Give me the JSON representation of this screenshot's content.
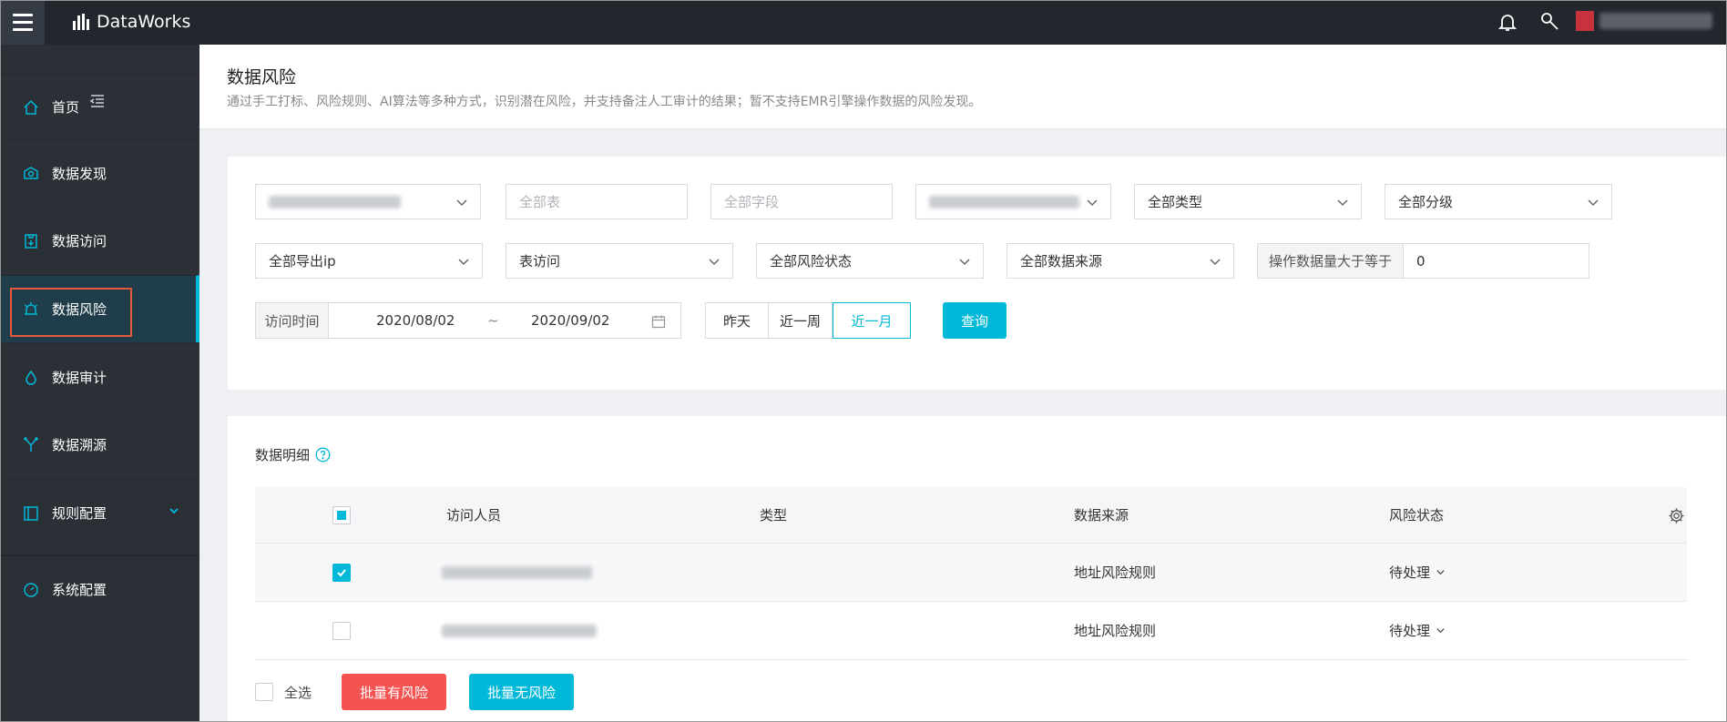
{
  "app": {
    "name": "DataWorks"
  },
  "sidebar": {
    "items": [
      {
        "label": "首页",
        "icon": "home-icon"
      },
      {
        "label": "数据发现",
        "icon": "discover-icon"
      },
      {
        "label": "数据访问",
        "icon": "access-icon"
      },
      {
        "label": "数据风险",
        "icon": "alarm-icon",
        "active": true
      },
      {
        "label": "数据审计",
        "icon": "drop-icon"
      },
      {
        "label": "数据溯源",
        "icon": "trace-icon"
      },
      {
        "label": "规则配置",
        "icon": "rule-icon",
        "expandable": true
      },
      {
        "label": "系统配置",
        "icon": "gauge-icon"
      }
    ]
  },
  "header": {
    "title": "数据风险",
    "description": "通过手工打标、风险规则、AI算法等多种方式，识别潜在风险，并支持备注人工审计的结果；暂不支持EMR引擎操作数据的风险发现。"
  },
  "filters": {
    "table_placeholder": "全部表",
    "field_placeholder": "全部字段",
    "type": "全部类型",
    "level": "全部分级",
    "export_ip": "全部导出ip",
    "access": "表访问",
    "risk_status": "全部风险状态",
    "data_source": "全部数据来源",
    "op_count_label": "操作数据量大于等于",
    "op_count_value": "0",
    "time_label": "访问时间",
    "date_from": "2020/08/02",
    "date_sep": "~",
    "date_to": "2020/09/02",
    "quick": [
      "昨天",
      "近一周",
      "近一月"
    ],
    "quick_active": "近一月",
    "query_button": "查询"
  },
  "details": {
    "title": "数据明细",
    "columns": [
      "访问人员",
      "类型",
      "数据来源",
      "风险状态"
    ],
    "rows": [
      {
        "checked": true,
        "type": "",
        "source": "地址风险规则",
        "status": "待处理"
      },
      {
        "checked": false,
        "type": "",
        "source": "地址风险规则",
        "status": "待处理"
      }
    ],
    "select_all": "全选",
    "batch_risk": "批量有风险",
    "batch_no_risk": "批量无风险"
  },
  "colors": {
    "accent": "#00b8d8",
    "danger": "#f55252",
    "sidebar_bg": "#2b3037",
    "topbar_bg": "#22272d"
  }
}
